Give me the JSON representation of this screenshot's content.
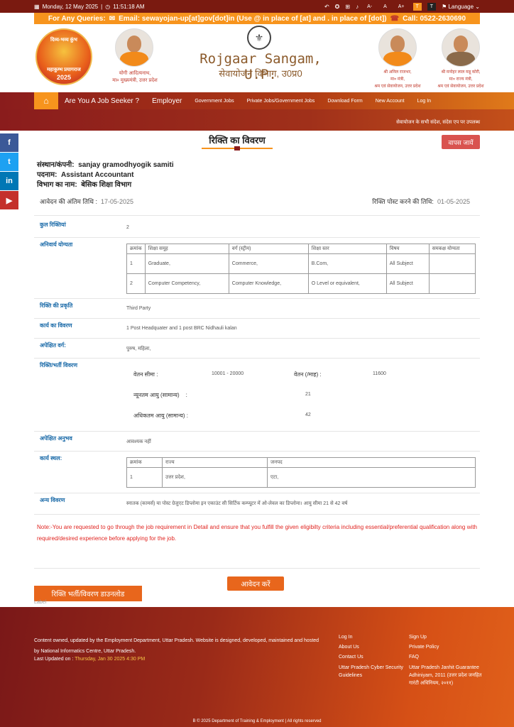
{
  "topbar": {
    "date": "Monday, 12 May 2025",
    "time": "11:51:18 AM",
    "font_small": "A-",
    "font_normal": "A",
    "font_large": "A+",
    "theme1": "T",
    "theme2": "T",
    "language": "Language"
  },
  "query_bar": {
    "label": "For Any Queries:",
    "email": "Email: sewayojan-up[at]gov[dot]in (Use @ in place of [at] and . in place of [dot])",
    "call": "Call: 0522-2630690"
  },
  "header": {
    "kumbh_top": "दिव्य-भव्य कुंभ",
    "kumbh_bottom": "महाकुम्भ प्रयागराज",
    "kumbh_year": "2025",
    "left_person_name": "योगी आदित्यनाथ,",
    "left_person_role": "मा० मुख्यमंत्री, उत्तर प्रदेश",
    "brand_title": "Rojgaar Sangam, U.P.",
    "brand_subtitle": "सेवायोजन विभाग, उ0प्र0",
    "right1_name": "श्री अनिल राजभर,",
    "right1_role1": "मा० मंत्री,",
    "right1_role2": "श्रम एवं सेवायोजन, उत्तर प्रदेश",
    "right2_name": "श्री मनोहर लाल मन्नू कोरी,",
    "right2_role1": "मा० राज्य मंत्री,",
    "right2_role2": "श्रम एवं सेवायोजन, उत्तर प्रदेश"
  },
  "nav": {
    "items": [
      "Are You A Job Seeker ?",
      "Employer",
      "Government Jobs",
      "Private Jobs/Government Jobs",
      "Download Form",
      "New Account",
      "Log In"
    ]
  },
  "ticker": "सेवायोजन के सभी संदेश, संदेस एप पर उपलब्ध",
  "page": {
    "title": "रिक्ति का विवरण",
    "back_button": "वापस जायें",
    "org_label": "संस्थान/कंपनी:",
    "org_value": "sanjay gramodhyogik samiti",
    "post_label": "पदनाम:",
    "post_value": "Assistant Accountant",
    "dept_label": "विभाग का नाम:",
    "dept_value": "बेसिक शिक्षा विभाग",
    "last_date_label": "आवेदन की अंतिम तिथि :",
    "last_date_value": "17-05-2025",
    "post_date_label": "रिक्ति पोस्ट करने की तिथि:",
    "post_date_value": "01-05-2025"
  },
  "details": {
    "total_label": "कुल रिक्तियां",
    "total_value": "2",
    "qual_label": "अनिवार्य योग्यता",
    "qual_headers": [
      "क्रमांक",
      "शिक्षा समूह",
      "वर्ग (स्ट्रीम)",
      "शिक्षा स्तर",
      "विषय",
      "समकक्ष योग्यता"
    ],
    "qual_rows": [
      [
        "1",
        "Graduate,",
        "Commerce,",
        "B.Com,",
        "All Subject",
        ""
      ],
      [
        "2",
        "Computer Competency,",
        "Computer Knowledge,",
        "O Level or equivalent,",
        "All Subject",
        ""
      ]
    ],
    "nature_label": "रिक्ति की प्रकृति",
    "nature_value": "Third Party",
    "work_label": "कार्य का विवरण",
    "work_value": "1 Post Headquater and 1 post BRC Nidhauli kalan",
    "category_label": "अपेक्षित वर्ग:",
    "category_value": "पुरुष, महिला,",
    "vacancy_label": "रिक्ति/भर्ती विवरण",
    "salary_range_label": "वेतन सीमा :",
    "salary_range_value": "10001 - 20000",
    "salary_month_label": "वेतन (/माह) :",
    "salary_month_value": "11600",
    "min_age_label": "न्यूनतम आयु (सामान्य)",
    "min_age_sep": ":",
    "min_age_value": "21",
    "max_age_label": "अधिकतम आयु (सामान्य) :",
    "max_age_value": "42",
    "exp_label": "अपेक्षित अनुभव",
    "exp_value": "आवश्यक नहीं",
    "place_label": "कार्य स्थल:",
    "place_headers": [
      "क्रमांक",
      "राज्य",
      "जनपद"
    ],
    "place_rows": [
      [
        "1",
        "उत्तर प्रदेश,",
        "एटा,"
      ]
    ],
    "other_label": "अन्य विवरण",
    "other_value": "स्नातक (कामर्स) या पोस्ट ग्रेजुएट डिप्लोमा इन एकाउंट सी सिर्टिफ कम्प्यूटर में ओ-लेवल का डिप्लोमा। आयु सीमा 21 से 42 वर्ष"
  },
  "note": "Note:-You are requested to go through the job requirement in Detail and ensure that you fulfill the given eligibilty criteria including essential/preferential qualification along with required/desired experience before applying for the job.",
  "actions": {
    "apply": "आवेदन करें",
    "download": "रिक्ति भर्ती/विवरण डाउनलोड",
    "label": "Label"
  },
  "footer": {
    "text": "Content owned, updated by the Employment Department, Uttar Pradesh. Website is designed, developed, maintained and hosted by National Informatics Centre, Uttar Pradesh.",
    "updated_label": "Last Updated on :",
    "updated_value": "Thursday, Jan 30 2025 4:30 PM",
    "col1": [
      "Log In",
      "About Us",
      "Contact Us",
      "Uttar Pradesh Cyber Security Guidelines"
    ],
    "col2": [
      "Sign Up",
      "Private Policy",
      "FAQ",
      "Uttar Pradesh Janhit Guarantee Adhiniyam, 2011 (उत्तर प्रदेश जनहित गारंटी अधिनियम, २०११)"
    ],
    "copyright": "B © 2025 Department of Training & Employment | All rights reserved"
  }
}
